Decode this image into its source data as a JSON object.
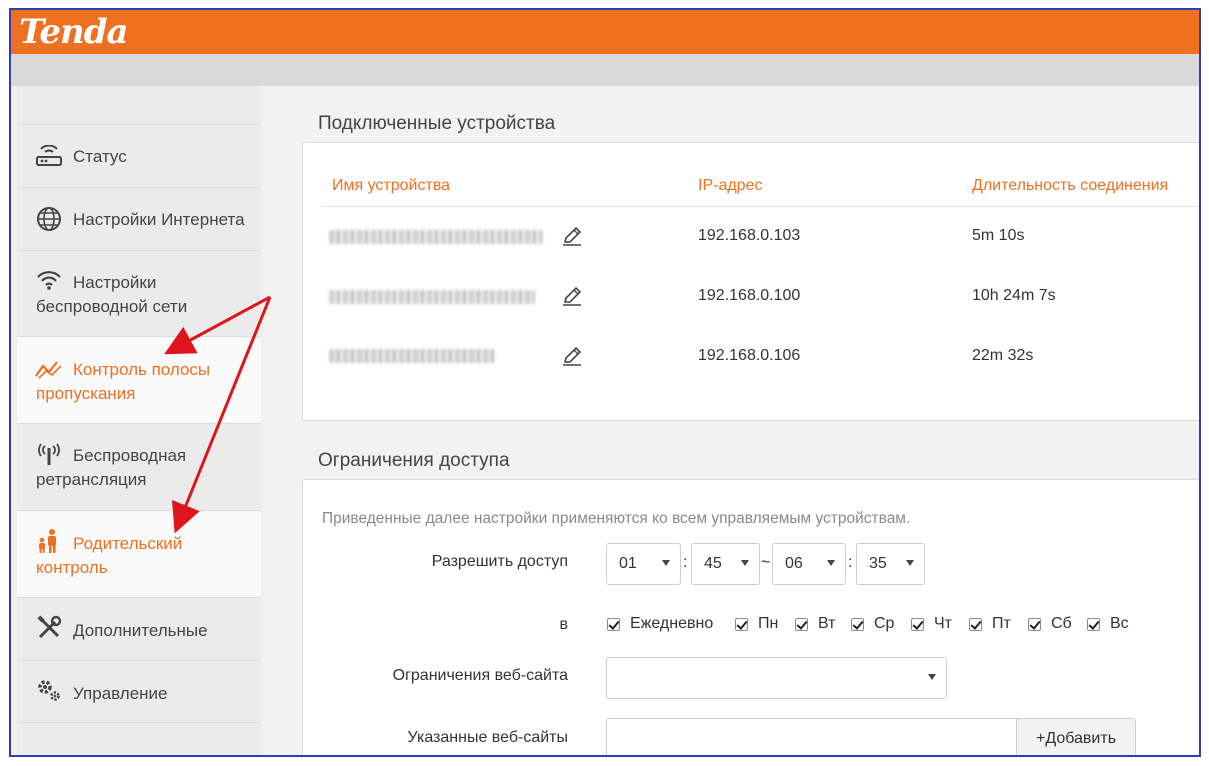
{
  "brand": {
    "logo": "Tenda",
    "accent": "#f07022",
    "frame_border": "#2f3fb0",
    "arrow_color": "#e0151b"
  },
  "sidebar": {
    "items": [
      {
        "line1": "Статус",
        "line2": "",
        "icon": "router-icon",
        "active": false
      },
      {
        "line1": "Настройки Интернета",
        "line2": "",
        "icon": "globe-icon",
        "active": false
      },
      {
        "line1": "Настройки",
        "line2": "беспроводной сети",
        "icon": "wifi-icon",
        "active": false
      },
      {
        "line1": "Контроль полосы",
        "line2": "пропускания",
        "icon": "bandwidth-chart-icon",
        "active": true
      },
      {
        "line1": "Беспроводная",
        "line2": "ретрансляция",
        "icon": "antenna-icon",
        "active": false
      },
      {
        "line1": "Родительский",
        "line2": "контроль",
        "icon": "parent-child-icon",
        "active": true
      },
      {
        "line1": "Дополнительные",
        "line2": "",
        "icon": "tools-icon",
        "active": false
      },
      {
        "line1": "Управление",
        "line2": "",
        "icon": "gears-icon",
        "active": false
      }
    ]
  },
  "devices": {
    "title": "Подключенные устройства",
    "columns": [
      "Имя устройства",
      "IP-адрес",
      "Длительность соединения"
    ],
    "rows": [
      {
        "name_blurred": true,
        "ip": "192.168.0.103",
        "duration": "5m 10s"
      },
      {
        "name_blurred": true,
        "ip": "192.168.0.100",
        "duration": "10h 24m 7s"
      },
      {
        "name_blurred": true,
        "ip": "192.168.0.106",
        "duration": "22m 32s"
      }
    ]
  },
  "access": {
    "title": "Ограничения доступа",
    "note": "Приведенные далее настройки применяются ко всем управляемым устройствам.",
    "allow_label": "Разрешить доступ",
    "time": {
      "start_hour": "01",
      "start_min": "45",
      "separator": "~",
      "end_hour": "06",
      "end_min": "35",
      "colon": ":"
    },
    "days_label": "в",
    "days": [
      {
        "label": "Ежедневно",
        "checked": true
      },
      {
        "label": "Пн",
        "checked": true
      },
      {
        "label": "Вт",
        "checked": true
      },
      {
        "label": "Ср",
        "checked": true
      },
      {
        "label": "Чт",
        "checked": true
      },
      {
        "label": "Пт",
        "checked": true
      },
      {
        "label": "Сб",
        "checked": true
      },
      {
        "label": "Вс",
        "checked": true
      }
    ],
    "web_limit_label": "Ограничения веб-сайта",
    "web_limit_value": "",
    "sites_label": "Указанные веб-сайты",
    "sites_value": "",
    "add_button": "+Добавить"
  }
}
